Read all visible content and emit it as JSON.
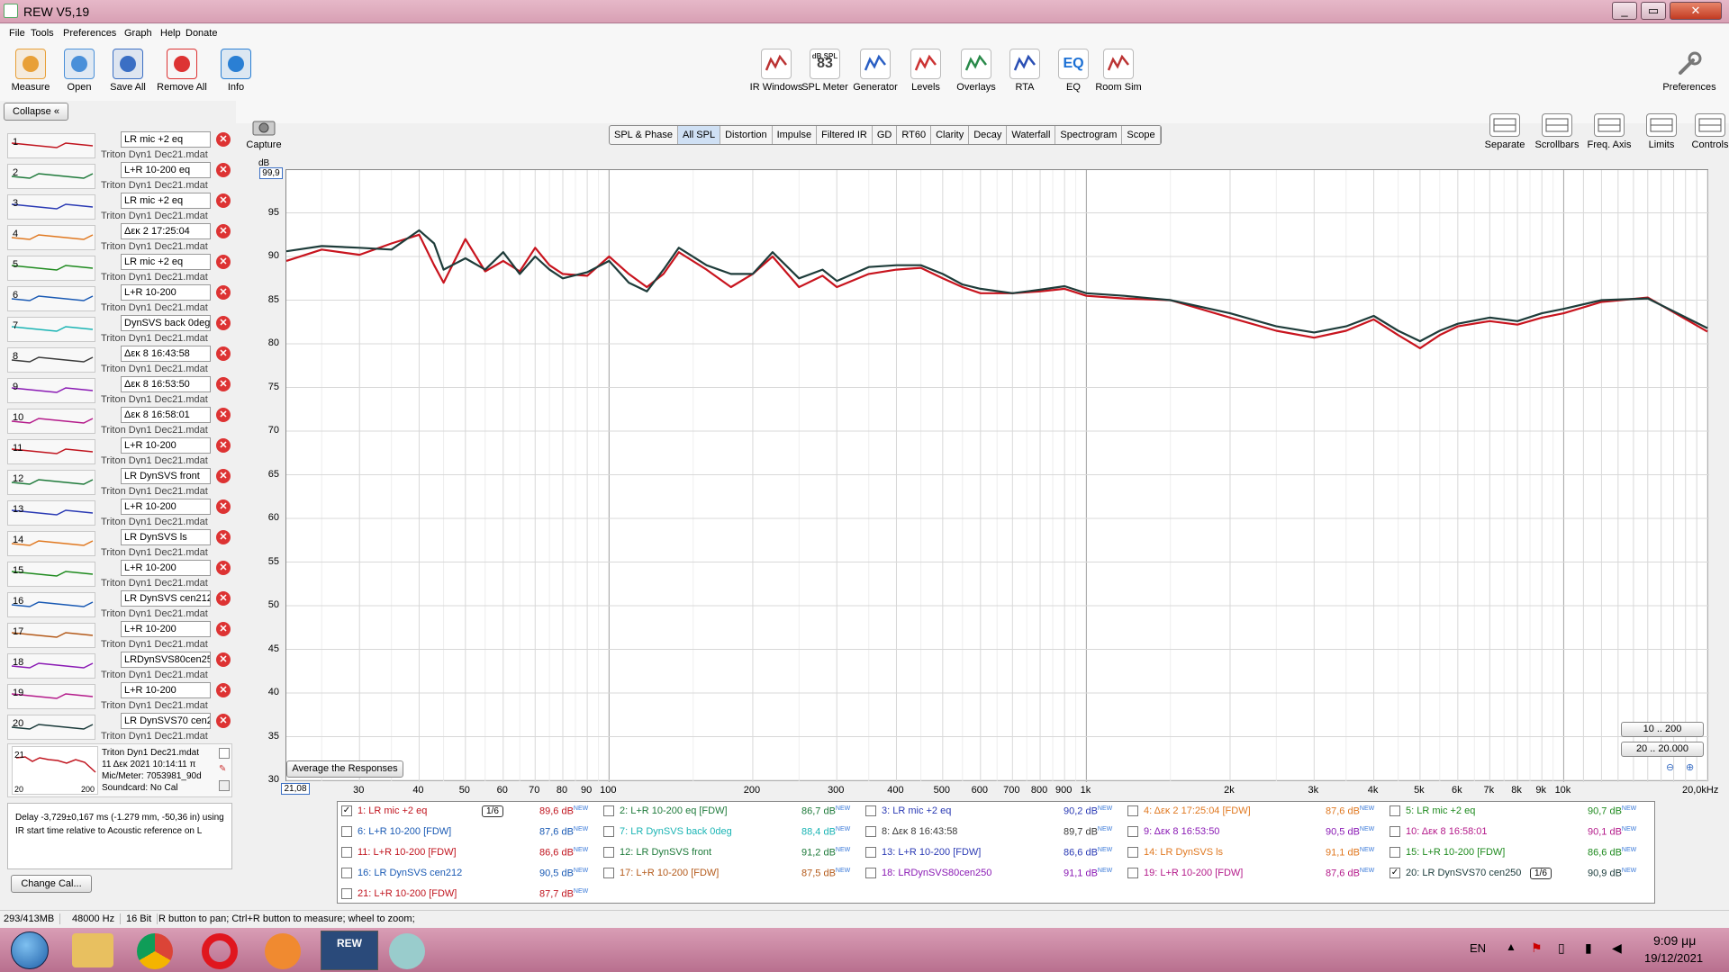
{
  "window": {
    "title": "REW V5,19"
  },
  "menu": [
    "File",
    "Tools",
    "Preferences",
    "Graph",
    "Help",
    "Donate"
  ],
  "toolbar_left": [
    {
      "label": "Measure",
      "icon": "measure-icon",
      "color": "#e8a038"
    },
    {
      "label": "Open",
      "icon": "folder-icon",
      "color": "#4a90d9"
    },
    {
      "label": "Save All",
      "icon": "save-icon",
      "color": "#3b6fc4"
    },
    {
      "label": "Remove All",
      "icon": "remove-icon",
      "color": "#d33"
    },
    {
      "label": "Info",
      "icon": "info-icon",
      "color": "#2a7fd4"
    }
  ],
  "toolbar_center": [
    {
      "label": "IR Windows",
      "icon": "ir-windows-icon",
      "color": "#b33"
    },
    {
      "label": "SPL Meter",
      "icon": "spl-meter-icon",
      "color": "#444",
      "text": "83",
      "subtext": "dB SPL"
    },
    {
      "label": "Generator",
      "icon": "generator-icon",
      "color": "#2a5fc4"
    },
    {
      "label": "Levels",
      "icon": "levels-icon",
      "color": "#c33"
    },
    {
      "label": "Overlays",
      "icon": "overlays-icon",
      "color": "#2a8a4a"
    },
    {
      "label": "RTA",
      "icon": "rta-icon",
      "color": "#2a4fb4"
    },
    {
      "label": "EQ",
      "icon": "eq-icon",
      "color": "#1a6fd4",
      "text": "EQ"
    },
    {
      "label": "Room Sim",
      "icon": "room-sim-icon",
      "color": "#b33"
    }
  ],
  "toolbar_right": {
    "label": "Preferences",
    "icon": "wrench-icon"
  },
  "graph_tools": [
    {
      "label": "Separate",
      "icon": "separate-icon"
    },
    {
      "label": "Scrollbars",
      "icon": "scrollbars-icon"
    },
    {
      "label": "Freq. Axis",
      "icon": "freq-axis-icon"
    },
    {
      "label": "Limits",
      "icon": "limits-icon"
    },
    {
      "label": "Controls",
      "icon": "gear-icon"
    }
  ],
  "capture": {
    "label": "Capture",
    "icon": "camera-icon"
  },
  "tabs": [
    "SPL & Phase",
    "All SPL",
    "Distortion",
    "Impulse",
    "Filtered IR",
    "GD",
    "RT60",
    "Clarity",
    "Decay",
    "Waterfall",
    "Spectrogram",
    "Scope"
  ],
  "active_tab": "All SPL",
  "left": {
    "collapse_label": "Collapse",
    "rows": [
      {
        "n": "1",
        "name": "LR mic +2 eq",
        "sub": "Triton Dyn1 Dec21.mdat",
        "color": "#c0141e"
      },
      {
        "n": "2",
        "name": "L+R 10-200 eq",
        "sub": "Triton Dyn1 Dec21.mdat",
        "color": "#1e7a3a"
      },
      {
        "n": "3",
        "name": "LR mic +2 eq",
        "sub": "Triton Dyn1 Dec21.mdat",
        "color": "#2a3ab4"
      },
      {
        "n": "4",
        "name": "Δεκ 2 17:25:04",
        "sub": "Triton Dyn1 Dec21.mdat",
        "color": "#e07820"
      },
      {
        "n": "5",
        "name": "LR mic +2 eq",
        "sub": "Triton Dyn1 Dec21.mdat",
        "color": "#1e8a1e"
      },
      {
        "n": "6",
        "name": "L+R 10-200",
        "sub": "Triton Dyn1 Dec21.mdat",
        "color": "#1a5ab4"
      },
      {
        "n": "7",
        "name": "DynSVS back 0deg",
        "sub": "Triton Dyn1 Dec21.mdat",
        "color": "#1ab4b4"
      },
      {
        "n": "8",
        "name": "Δεκ 8 16:43:58",
        "sub": "Triton Dyn1 Dec21.mdat",
        "color": "#3a3a3a"
      },
      {
        "n": "9",
        "name": "Δεκ 8 16:53:50",
        "sub": "Triton Dyn1 Dec21.mdat",
        "color": "#8a1ab4"
      },
      {
        "n": "10",
        "name": "Δεκ 8 16:58:01",
        "sub": "Triton Dyn1 Dec21.mdat",
        "color": "#b41a8a"
      },
      {
        "n": "11",
        "name": "L+R  10-200",
        "sub": "Triton Dyn1 Dec21.mdat",
        "color": "#c0141e"
      },
      {
        "n": "12",
        "name": "LR DynSVS front",
        "sub": "Triton Dyn1 Dec21.mdat",
        "color": "#1e7a3a"
      },
      {
        "n": "13",
        "name": "L+R 10-200",
        "sub": "Triton Dyn1 Dec21.mdat",
        "color": "#2a3ab4"
      },
      {
        "n": "14",
        "name": "LR DynSVS ls",
        "sub": "Triton Dyn1 Dec21.mdat",
        "color": "#e07820"
      },
      {
        "n": "15",
        "name": "L+R 10-200",
        "sub": "Triton Dyn1 Dec21.mdat",
        "color": "#1e8a1e"
      },
      {
        "n": "16",
        "name": "LR DynSVS cen212",
        "sub": "Triton Dyn1 Dec21.mdat",
        "color": "#1a5ab4"
      },
      {
        "n": "17",
        "name": "L+R 10-200",
        "sub": "Triton Dyn1 Dec21.mdat",
        "color": "#b45a1a"
      },
      {
        "n": "18",
        "name": "LRDynSVS80cen250",
        "sub": "Triton Dyn1 Dec21.mdat",
        "color": "#8a1ab4"
      },
      {
        "n": "19",
        "name": "L+R 10-200",
        "sub": "Triton Dyn1 Dec21.mdat",
        "color": "#b41a8a"
      },
      {
        "n": "20",
        "name": "LR DynSVS70 cen250",
        "sub": "Triton Dyn1 Dec21.mdat",
        "color": "#1a3a3a"
      }
    ],
    "row21": {
      "n": "21",
      "name": "L+R 10-200",
      "file": "Triton Dyn1 Dec21.mdat",
      "date": "11 Δεκ 2021 10:14:11 π",
      "mic": "Mic/Meter: 7053981_90d",
      "soundcard": "Soundcard: No Cal",
      "axis_lo": "20",
      "axis_hi": "200"
    },
    "delay_text": "Delay -3,729±0,167 ms (-1.279 mm, -50,36 in) using IR start time relative to Acoustic reference on  L",
    "change_cal": "Change Cal..."
  },
  "graph": {
    "y_unit": "dB",
    "y_top_value": "99,9",
    "x_left_value": "21,08",
    "avg_button": "Average the Responses",
    "range_btn1": "10 .. 200",
    "range_btn2": "20 .. 20.000",
    "y_ticks": [
      95,
      90,
      85,
      80,
      75,
      70,
      65,
      60,
      55,
      50,
      45,
      40,
      35,
      30
    ],
    "x_ticks": [
      {
        "v": 30,
        "t": "30"
      },
      {
        "v": 40,
        "t": "40"
      },
      {
        "v": 50,
        "t": "50"
      },
      {
        "v": 60,
        "t": "60"
      },
      {
        "v": 70,
        "t": "70"
      },
      {
        "v": 80,
        "t": "80"
      },
      {
        "v": 90,
        "t": "90"
      },
      {
        "v": 100,
        "t": "100"
      },
      {
        "v": 200,
        "t": "200"
      },
      {
        "v": 300,
        "t": "300"
      },
      {
        "v": 400,
        "t": "400"
      },
      {
        "v": 500,
        "t": "500"
      },
      {
        "v": 600,
        "t": "600"
      },
      {
        "v": 700,
        "t": "700"
      },
      {
        "v": 800,
        "t": "800"
      },
      {
        "v": 900,
        "t": "900"
      },
      {
        "v": 1000,
        "t": "1k"
      },
      {
        "v": 2000,
        "t": "2k"
      },
      {
        "v": 3000,
        "t": "3k"
      },
      {
        "v": 4000,
        "t": "4k"
      },
      {
        "v": 5000,
        "t": "5k"
      },
      {
        "v": 6000,
        "t": "6k"
      },
      {
        "v": 7000,
        "t": "7k"
      },
      {
        "v": 8000,
        "t": "8k"
      },
      {
        "v": 9000,
        "t": "9k"
      },
      {
        "v": 10000,
        "t": "10k"
      },
      {
        "v": 20000,
        "t": "20,0kHz"
      }
    ]
  },
  "chart_data": {
    "type": "line",
    "x_scale": "log",
    "xlim": [
      21.08,
      20000
    ],
    "ylim": [
      30,
      99.9
    ],
    "ylabel": "dB",
    "grid": true,
    "series": [
      {
        "name": "1: LR mic +2 eq",
        "color": "#c8141e",
        "x": [
          21.08,
          25,
          30,
          35,
          40,
          43,
          45,
          50,
          55,
          60,
          65,
          70,
          75,
          80,
          90,
          100,
          110,
          120,
          130,
          140,
          160,
          180,
          200,
          220,
          250,
          280,
          300,
          350,
          400,
          450,
          500,
          550,
          600,
          700,
          800,
          900,
          1000,
          1200,
          1500,
          2000,
          2500,
          3000,
          3500,
          4000,
          4500,
          5000,
          5500,
          6000,
          7000,
          8000,
          9000,
          10000,
          12000,
          15000,
          20000
        ],
        "y": [
          89.5,
          90.8,
          90.2,
          91.5,
          92.5,
          89,
          87,
          92,
          88.3,
          89.5,
          88.3,
          91,
          89,
          88,
          87.8,
          90,
          88,
          86.5,
          88,
          90.5,
          88.5,
          86.5,
          88,
          90,
          86.5,
          87.8,
          86.5,
          88,
          88.5,
          88.7,
          87.5,
          86.5,
          85.8,
          85.8,
          86,
          86.3,
          85.5,
          85.2,
          85,
          83,
          81.5,
          80.7,
          81.5,
          82.8,
          81,
          79.5,
          81,
          82,
          82.6,
          82.2,
          83,
          83.5,
          84.8,
          85.3,
          81.4
        ]
      },
      {
        "name": "20: LR DynSVS70 cen250",
        "color": "#1e3c3a",
        "x": [
          21.08,
          25,
          30,
          35,
          40,
          43,
          45,
          50,
          55,
          60,
          65,
          70,
          75,
          80,
          90,
          100,
          110,
          120,
          130,
          140,
          160,
          180,
          200,
          220,
          250,
          280,
          300,
          350,
          400,
          450,
          500,
          550,
          600,
          700,
          800,
          900,
          1000,
          1200,
          1500,
          2000,
          2500,
          3000,
          3500,
          4000,
          4500,
          5000,
          5500,
          6000,
          7000,
          8000,
          9000,
          10000,
          12000,
          15000,
          20000
        ],
        "y": [
          90.6,
          91.2,
          91,
          90.8,
          93,
          91.5,
          88.5,
          89.8,
          88.5,
          90.5,
          88,
          90,
          88.5,
          87.5,
          88.2,
          89.5,
          87,
          86,
          88.5,
          91,
          89,
          88,
          88,
          90.5,
          87.5,
          88.5,
          87.2,
          88.8,
          89,
          89,
          88,
          86.8,
          86.3,
          85.8,
          86.2,
          86.6,
          85.8,
          85.5,
          85,
          83.5,
          82,
          81.3,
          82,
          83.2,
          81.5,
          80.3,
          81.5,
          82.3,
          83,
          82.6,
          83.5,
          84,
          85,
          85.2,
          81.8
        ]
      }
    ]
  },
  "legend": [
    {
      "label": "1: LR mic +2 eq",
      "value": "89,6 dB",
      "color": "#c0141e",
      "checked": true,
      "smooth": "1/6"
    },
    {
      "label": "2: L+R 10-200 eq [FDW]",
      "value": "86,7 dB",
      "color": "#1e7a3a",
      "checked": false
    },
    {
      "label": "3: LR mic +2 eq",
      "value": "90,2 dB",
      "color": "#2a3ab4",
      "checked": false
    },
    {
      "label": "4: Δεκ 2 17:25:04 [FDW]",
      "value": "87,6 dB",
      "color": "#e07820",
      "checked": false
    },
    {
      "label": "5: LR mic +2 eq",
      "value": "90,7 dB",
      "color": "#1e8a1e",
      "checked": false
    },
    {
      "label": "6: L+R 10-200 [FDW]",
      "value": "87,6 dB",
      "color": "#1a5ab4",
      "checked": false
    },
    {
      "label": "7: LR DynSVS back 0deg",
      "value": "88,4 dB",
      "color": "#1ab4b4",
      "checked": false
    },
    {
      "label": "8: Δεκ 8 16:43:58",
      "value": "89,7 dB",
      "color": "#3a3a3a",
      "checked": false
    },
    {
      "label": "9: Δεκ 8 16:53:50",
      "value": "90,5 dB",
      "color": "#8a1ab4",
      "checked": false
    },
    {
      "label": "10: Δεκ 8 16:58:01",
      "value": "90,1 dB",
      "color": "#b41a8a",
      "checked": false
    },
    {
      "label": "11: L+R  10-200 [FDW]",
      "value": "86,6 dB",
      "color": "#c0141e",
      "checked": false
    },
    {
      "label": "12: LR DynSVS front",
      "value": "91,2 dB",
      "color": "#1e7a3a",
      "checked": false
    },
    {
      "label": "13: L+R 10-200 [FDW]",
      "value": "86,6 dB",
      "color": "#2a3ab4",
      "checked": false
    },
    {
      "label": "14: LR DynSVS ls",
      "value": "91,1 dB",
      "color": "#e07820",
      "checked": false
    },
    {
      "label": "15: L+R 10-200 [FDW]",
      "value": "86,6 dB",
      "color": "#1e8a1e",
      "checked": false
    },
    {
      "label": "16: LR DynSVS cen212",
      "value": "90,5 dB",
      "color": "#1a5ab4",
      "checked": false
    },
    {
      "label": "17: L+R 10-200 [FDW]",
      "value": "87,5 dB",
      "color": "#b45a1a",
      "checked": false
    },
    {
      "label": "18: LRDynSVS80cen250",
      "value": "91,1 dB",
      "color": "#8a1ab4",
      "checked": false
    },
    {
      "label": "19: L+R 10-200 [FDW]",
      "value": "87,6 dB",
      "color": "#b41a8a",
      "checked": false
    },
    {
      "label": "20: LR DynSVS70 cen250",
      "value": "90,9 dB",
      "color": "#1a3a3a",
      "checked": true,
      "smooth": "1/6"
    },
    {
      "label": "21: L+R 10-200 [FDW]",
      "value": "87,7 dB",
      "color": "#c0141e",
      "checked": false
    }
  ],
  "new_badge": "NEW",
  "status": {
    "memory": "293/413MB",
    "rate": "48000 Hz",
    "bits": "16 Bit",
    "hint": "R button to pan; Ctrl+R button to measure; wheel to zoom;"
  },
  "taskbar": {
    "lang": "EN",
    "time": "9:09 μμ",
    "date": "19/12/2021"
  }
}
